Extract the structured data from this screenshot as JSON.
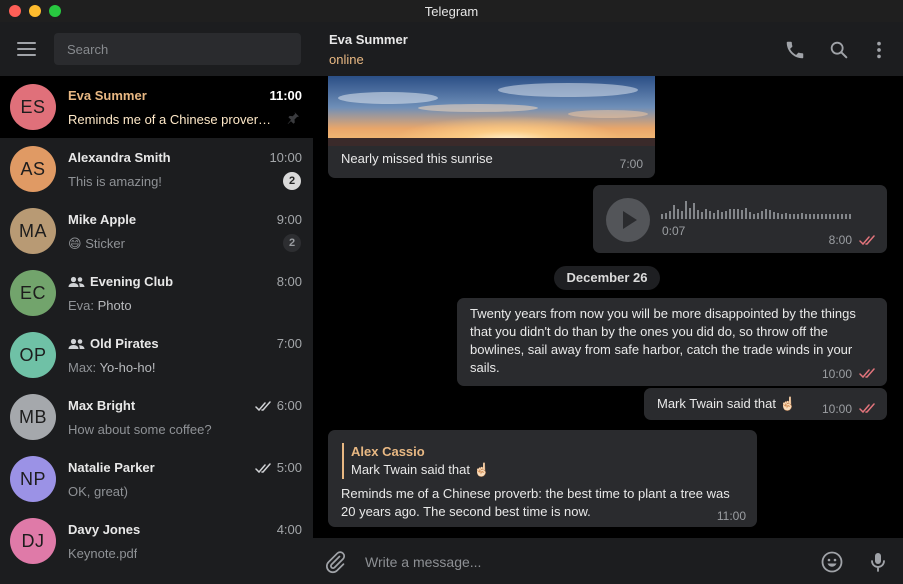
{
  "window": {
    "title": "Telegram"
  },
  "sidebar": {
    "search_placeholder": "Search",
    "chats": [
      {
        "initials": "ES",
        "name": "Eva Summer",
        "time": "11:00",
        "preview": "Reminds me of a Chinese prover…",
        "pinned": true,
        "active": true,
        "color": "#e0707a"
      },
      {
        "initials": "AS",
        "name": "Alexandra Smith",
        "time": "10:00",
        "preview": "This is amazing!",
        "badge": "2",
        "color": "#e09a64"
      },
      {
        "initials": "MA",
        "name": "Mike Apple",
        "time": "9:00",
        "preview": "Sticker",
        "preview_emoji": "😄",
        "badge": "2",
        "badge_muted": true,
        "color": "#b89a74"
      },
      {
        "initials": "EC",
        "name": "Evening Club",
        "time": "8:00",
        "sender": "Eva:",
        "preview": "Photo",
        "group": true,
        "color": "#72a46c"
      },
      {
        "initials": "OP",
        "name": "Old Pirates",
        "time": "7:00",
        "sender": "Max:",
        "preview": "Yo-ho-ho!",
        "group": true,
        "color": "#6fc1a6"
      },
      {
        "initials": "MB",
        "name": "Max Bright",
        "time": "6:00",
        "preview": "How about some coffee?",
        "read": true,
        "color": "#a5a8ac"
      },
      {
        "initials": "NP",
        "name": "Natalie Parker",
        "time": "5:00",
        "preview": "OK, great)",
        "read": true,
        "color": "#9b92e6"
      },
      {
        "initials": "DJ",
        "name": "Davy Jones",
        "time": "4:00",
        "preview": "Keynote.pdf",
        "color": "#df7aa8"
      }
    ]
  },
  "header": {
    "peer_name": "Eva Summer",
    "peer_status": "online"
  },
  "messages": {
    "photo_caption": "Nearly missed this sunrise",
    "photo_time": "7:00",
    "voice_duration": "0:07",
    "voice_time": "8:00",
    "date_separator": "December 26",
    "quote_text": "Twenty years from now you will be more disappointed by the things that you didn't do than by the ones you did do, so throw off the bowlines, sail away from safe harbor, catch the trade winds in your sails.",
    "quote_time": "10:00",
    "twain_text": "Mark Twain said that ☝🏻",
    "twain_time": "10:00",
    "reply_author": "Alex Cassio",
    "reply_quote": "Mark Twain said that ☝🏻",
    "reply_text": "Reminds me of a Chinese proverb: the best time to plant a tree was 20 years ago. The second best time is now.",
    "reply_time": "11:00"
  },
  "composer": {
    "placeholder": "Write a message..."
  },
  "colors": {
    "accent": "#e8b883",
    "read_check": "#e2747c",
    "bubble": "#2a2b2e",
    "panel": "#1c1d1f"
  }
}
